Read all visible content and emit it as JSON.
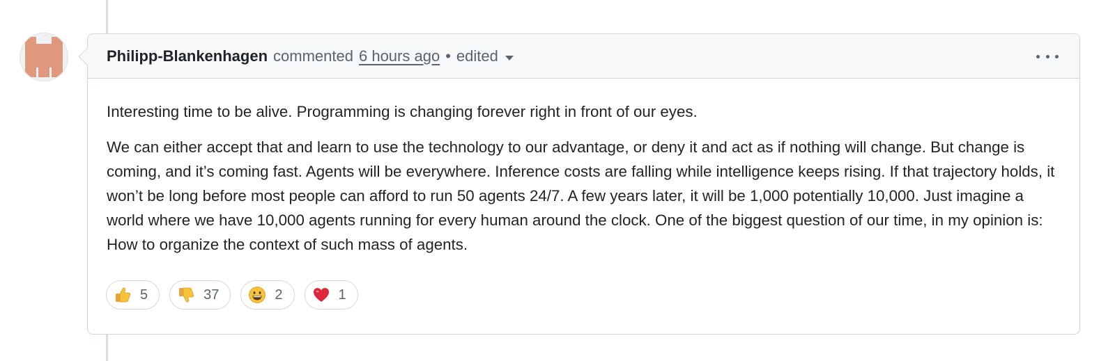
{
  "comment": {
    "author": "Philipp-Blankenhagen",
    "action": "commented",
    "time": "6 hours ago",
    "separator": "•",
    "edited_label": "edited",
    "paragraphs": [
      "Interesting time to be alive. Programming is changing forever right in front of our eyes.",
      "We can either accept that and learn to use the technology to our advantage, or deny it and act as if nothing will change. But change is coming, and it’s coming fast. Agents will be everywhere. Inference costs are falling while intelligence keeps rising. If that trajectory holds, it won’t be long before most people can afford to run 50 agents 24/7. A few years later, it will be 1,000 potentially 10,000. Just imagine a world where we have 10,000 agents running for every human around the clock. One of the biggest question of our time, in my opinion is: How to organize the context of such mass of agents."
    ],
    "reactions": [
      {
        "icon": "thumbs-up-icon",
        "count": "5"
      },
      {
        "icon": "thumbs-down-icon",
        "count": "37"
      },
      {
        "icon": "grinning-face-icon",
        "count": "2"
      },
      {
        "icon": "red-heart-icon",
        "count": "1"
      }
    ]
  },
  "colors": {
    "avatar": "#e0987c",
    "header_bg": "#f6f8fa",
    "border": "#cfd6de",
    "muted_text": "#59636e",
    "text": "#1f2328"
  }
}
